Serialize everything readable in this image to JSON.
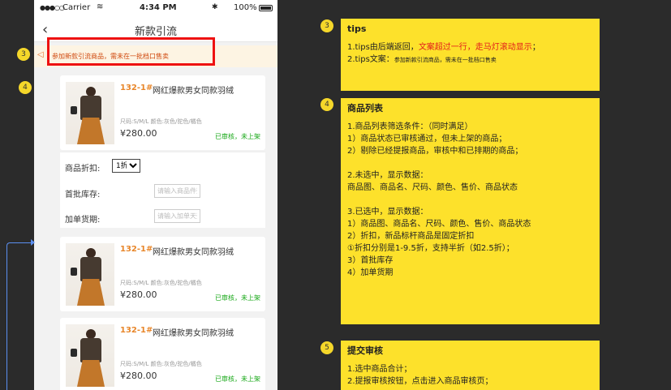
{
  "status_bar": {
    "carrier": "Carrier",
    "time": "4:34 PM",
    "battery": "100%"
  },
  "nav": {
    "back_icon": "chevron-left-icon",
    "title": "新款引流"
  },
  "tips_bar": {
    "icon": "speaker-icon",
    "text": "参加新款引流商品，需未在一批档口售卖"
  },
  "products": [
    {
      "sku": "132-1#",
      "name": "网红爆款男女同款羽绒",
      "attrs": "尺码:S/M/L   颜色:灰色/驼色/橘色",
      "price": "¥280.00",
      "status": "已审核，未上架",
      "checked": true
    },
    {
      "sku": "132-1#",
      "name": "网红爆款男女同款羽绒",
      "attrs": "尺码:S/M/L   颜色:灰色/驼色/橘色",
      "price": "¥280.00",
      "status": "已审核，未上架",
      "checked": false
    },
    {
      "sku": "132-1#",
      "name": "网红爆款男女同款羽绒",
      "attrs": "尺码:S/M/L   颜色:灰色/驼色/橘色",
      "price": "¥280.00",
      "status": "已审核，未上架",
      "checked": false
    }
  ],
  "extra_fields": {
    "discount_label": "商品折扣:",
    "discount_value": "1折",
    "stock_label": "首批库存:",
    "stock_placeholder": "请输入商品件数",
    "delivery_label": "加单货期:",
    "delivery_placeholder": "请输入加单天数"
  },
  "badges": {
    "tips_left": "3",
    "list_left": "4",
    "tips_right": "3",
    "list_right": "4",
    "submit_right": "5"
  },
  "notes": {
    "tips": {
      "title": "tips",
      "line1_prefix": "1.tips由后端返回，",
      "line1_red": "文案超过一行，走马灯滚动显示",
      "line1_suffix": "；",
      "line2_prefix": "2.tips文案：",
      "line2_small": "参加新款引流商品，需未在一批档口售卖"
    },
    "list": {
      "title": "商品列表",
      "lines_a": [
        "1.商品列表筛选条件：（同时满足）",
        "1）商品状态已审核通过，但未上架的商品；",
        "2）剔除已经提报商品，审核中和已排期的商品；"
      ],
      "lines_b": [
        "2.未选中，显示数据：",
        "商品图、商品名、尺码、颜色、售价、商品状态"
      ],
      "lines_c": [
        "3.已选中，显示数据：",
        "1）商品图、商品名、尺码、颜色、售价、商品状态",
        "2）折扣，新品标杆商品是固定折扣",
        "①折扣分别是1-9.5折，支持半折（如2.5折）；",
        "3）首批库存",
        "4）加单货期"
      ]
    },
    "submit": {
      "title": "提交审核",
      "lines": [
        "1.选中商品合计；",
        "2.提报审核按钮，点击进入商品审核页；"
      ]
    }
  },
  "colors": {
    "background": "#2b2b2b",
    "note_yellow": "#fde12b",
    "badge_yellow": "#f5d72a",
    "sku_orange": "#e8862a",
    "status_green": "#18a818",
    "highlight_red": "#ee1111",
    "connector_blue": "#5b8ff0"
  }
}
